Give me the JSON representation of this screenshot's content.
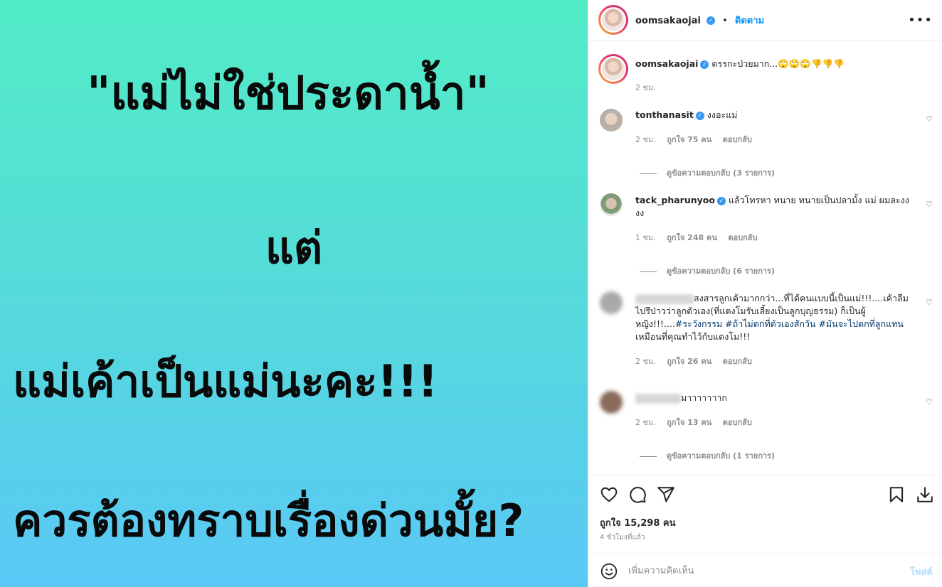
{
  "image": {
    "line1": "\"แม่ไม่ใช่ประดาน้ำ\"",
    "line2": "แต่",
    "line3": "แม่เค้าเป็นแม่นะคะ!!!",
    "line4": "ควรต้องทราบเรื่องด่วนมั้ย?"
  },
  "header": {
    "username": "oomsakaojai",
    "dot": "•",
    "follow_label": "ติดตาม",
    "more_icon": "more-horizontal-icon"
  },
  "caption": {
    "username": "oomsakaojai",
    "text": "ตรรกะป่วยมาก...🙄🙄🙄👎👎👎",
    "time": "2 ชม."
  },
  "comments": [
    {
      "username": "tonthanasit",
      "text": "งงอะแม่",
      "time": "2 ชม.",
      "likes": "ถูกใจ 75 คน",
      "reply": "ตอบกลับ",
      "view_replies": "ดูข้อความตอบกลับ (3 รายการ)"
    },
    {
      "username": "tack_pharunyoo",
      "text_line1": "แล้วโทรหา ทนาย ทนายเป็นปลามั้ง แม่ ผมละงง",
      "text_line2": "งง",
      "time": "1 ชม.",
      "likes": "ถูกใจ 248 คน",
      "reply": "ตอบกลับ",
      "view_replies": "ดูข้อความตอบกลับ (6 รายการ)"
    },
    {
      "username": "",
      "text_line1": "สงสารลูกเค้ามากกว่า...ที่ได้คนแบบนี้เป็นแม่!!!....เค้าลืม",
      "text_line2": "ไปรึป่าวว่าลูกตัวเอง(ที่แตงโมรับเลี้ยงเป็นลูกบุญธรรม) ก็เป็นผู้",
      "text_line3a": "หญิง!!!....",
      "hashtag1": "#ระวังกรรม",
      "hashtag2": "#ถ้าไม่ตกที่ตัวเองสักวัน",
      "hashtag3": "#มันจะไปตกที่ลูกแทน",
      "text_line4": "เหมือนที่คุณทำไว้กับแตงโม!!!",
      "time": "2 ชม.",
      "likes": "ถูกใจ 26 คน",
      "reply": "ตอบกลับ"
    },
    {
      "username": "",
      "text": "มาาาาาาาก",
      "time": "2 ชม.",
      "likes": "ถูกใจ 13 คน",
      "reply": "ตอบกลับ",
      "view_replies": "ดูข้อความตอบกลับ (1 รายการ)"
    }
  ],
  "actions": {
    "likes": "ถูกใจ 15,298 คน",
    "time": "4 ชั่วโมงที่แล้ว"
  },
  "add_comment": {
    "placeholder": "เพิ่มความคิดเห็น",
    "post_label": "โพสต์"
  }
}
